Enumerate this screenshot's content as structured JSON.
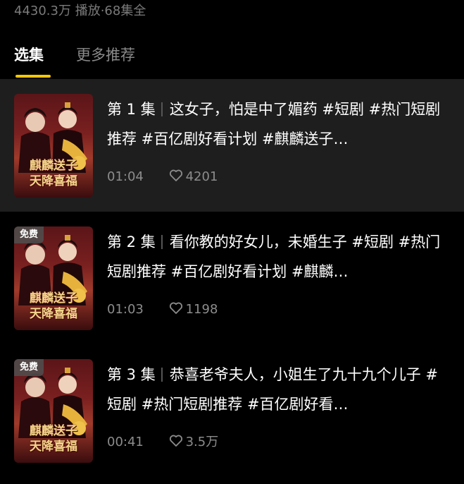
{
  "header": {
    "stats": "4430.3万 播放·68集全"
  },
  "tabs": [
    {
      "label": "选集",
      "active": true
    },
    {
      "label": "更多推荐",
      "active": false
    }
  ],
  "episodes": [
    {
      "number": "第 1 集",
      "title": "这女子，怕是中了媚药 #短剧 #热门短剧推荐 #百亿剧好看计划 #麒麟送子…",
      "duration": "01:04",
      "likes": "4201",
      "tag": "",
      "thumb_title_line1": "麒麟送子",
      "thumb_title_line2": "天降喜福",
      "current": true
    },
    {
      "number": "第 2 集",
      "title": "看你教的好女儿，未婚生子 #短剧 #热门短剧推荐 #百亿剧好看计划 #麒麟…",
      "duration": "01:03",
      "likes": "1198",
      "tag": "免费",
      "thumb_title_line1": "麒麟送子",
      "thumb_title_line2": "天降喜福",
      "current": false
    },
    {
      "number": "第 3 集",
      "title": "恭喜老爷夫人，小姐生了九十九个儿子 #短剧 #热门短剧推荐 #百亿剧好看…",
      "duration": "00:41",
      "likes": "3.5万",
      "tag": "免费",
      "thumb_title_line1": "麒麟送子",
      "thumb_title_line2": "天降喜福",
      "current": false
    }
  ],
  "icons": {
    "like": "heart-outline-icon"
  },
  "colors": {
    "background": "#000000",
    "current_row": "#1e1e1e",
    "tab_indicator": "#f7c600",
    "muted_text": "#8c8c8c"
  }
}
